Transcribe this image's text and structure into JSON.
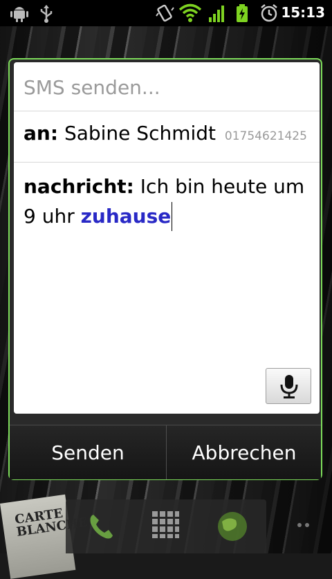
{
  "statusbar": {
    "time": "15:13",
    "icons": [
      "android-debug-icon",
      "usb-icon",
      "vibrate-icon",
      "wifi-icon",
      "signal-icon",
      "battery-charging-icon",
      "alarm-icon"
    ]
  },
  "wallpaper": {
    "book_text": "CARTE BLANCHE"
  },
  "dialog": {
    "title": "SMS senden...",
    "to": {
      "label": "an:",
      "name": "Sabine Schmidt",
      "number": "01754621425"
    },
    "message": {
      "label": "nachricht:",
      "text_before": "Ich bin heute um 9 uhr",
      "highlighted_word": "zuhause"
    },
    "mic_icon": "microphone-icon",
    "buttons": {
      "send": "Senden",
      "cancel": "Abbrechen"
    }
  },
  "dock": {
    "icons": [
      "phone-icon",
      "app-drawer-icon",
      "browser-globe-icon"
    ]
  },
  "colors": {
    "dialog_border": "#7ddc5a",
    "highlight": "#2929c6"
  }
}
